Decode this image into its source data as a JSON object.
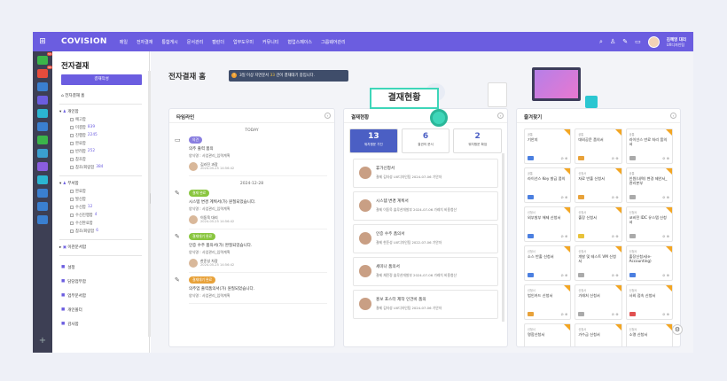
{
  "topnav": {
    "logo": "COVISION",
    "menu": [
      "메일",
      "전자결재",
      "통합게시",
      "문서관리",
      "캘린더",
      "업무도우미",
      "커뮤니티",
      "협업스페이스",
      "그룹웨어관리"
    ],
    "user_name": "김혜영 대리",
    "user_dept": "UX디자인팀"
  },
  "iconbar": {
    "badges": [
      "55",
      "99"
    ]
  },
  "sidebar": {
    "title": "전자결재",
    "write_btn": "결재작성",
    "home": "전자결재 홈",
    "personal": {
      "label": "개인함",
      "items": [
        {
          "label": "예고함",
          "count": ""
        },
        {
          "label": "미결함",
          "count": "839"
        },
        {
          "label": "진행함",
          "count": "2245"
        },
        {
          "label": "완료함",
          "count": ""
        },
        {
          "label": "반려함",
          "count": "252"
        },
        {
          "label": "참조함",
          "count": ""
        },
        {
          "label": "참조/회람함",
          "count": "384"
        }
      ]
    },
    "dept": {
      "label": "부서함",
      "items": [
        {
          "label": "완료함",
          "count": ""
        },
        {
          "label": "발신함",
          "count": ""
        },
        {
          "label": "수신함",
          "count": "12"
        },
        {
          "label": "수신진행함",
          "count": "4"
        },
        {
          "label": "수신완료함",
          "count": ""
        },
        {
          "label": "참조/회람함",
          "count": "6"
        }
      ]
    },
    "other": "이관문서함",
    "links": [
      "설정",
      "담당업무함",
      "업무문서함",
      "개인폴더",
      "감사함"
    ]
  },
  "main": {
    "title": "전자결재 홈",
    "notice_pre": "3일 이상 지연문서 ",
    "notice_num": "33",
    "notice_post": " 건이 결재대기 중입니다."
  },
  "timeline": {
    "title": "타임라인",
    "groups": [
      {
        "day": "TODAY",
        "items": [
          {
            "tag": "의견",
            "tag_color": "#8a7fe0",
            "title": "의주 출력 품의",
            "sub": "양식명 : 사업관리_입력계획",
            "user": "김라진 과장",
            "date": "2024-05-25 14:56:42"
          }
        ]
      },
      {
        "day": "2024-12-28",
        "items": [
          {
            "tag": "결재 완료",
            "tag_color": "#8ac640",
            "title": "시스템 변경 계획서(가) 원질되었습니다.",
            "sub": "양식명 : 사업관리_입력계획",
            "user": "이동욱 대리",
            "date": "2024-05-25 14:56:42"
          },
          {
            "tag": "결재대기 완료",
            "tag_color": "#8ac640",
            "title": "인증 수주 품의서(가) 완질되었습니다.",
            "sub": "양식명 : 사업관리_입력계획",
            "user": "한준성 차장",
            "date": "2024-05-25 14:56:42"
          },
          {
            "tag": "결재대기 완료",
            "tag_color": "#e8a23a",
            "title": "의주업 출력품의서(가) 원질되었습니다.",
            "sub": "양식명 : 사업관리_입력계획",
            "user": "",
            "date": ""
          }
        ]
      }
    ]
  },
  "approval": {
    "title": "결재현황",
    "stats": [
      {
        "value": "13",
        "label": "워치쟁운 가진"
      },
      {
        "value": "6",
        "label": "결권의 문서"
      },
      {
        "value": "2",
        "label": "워치쟁운 확엄"
      }
    ],
    "docs": [
      {
        "title": "휴가신청서",
        "sub": "결제 김자성 UX디자인팀 2024-07-06 기안자"
      },
      {
        "title": "시스템 변경 계획서",
        "sub": "결제 이동욱 솔루션개발부 2024-07-06 가레치 비용청산"
      },
      {
        "title": "인증 수주 품의서",
        "sub": "결제 한준성 UX디자인팀 2022-07-06 기안자"
      },
      {
        "title": "세미나 품의서",
        "sub": "결제 채민정 솔루션개발부 2024-07-06 가레치 비용청산"
      },
      {
        "title": "홍보 포스터 제작 인건비 품의",
        "sub": "결제 김자성 UX디자인팀 2024-07-06 기안자"
      }
    ]
  },
  "favorites": {
    "title": "즐겨찾기",
    "items": [
      {
        "type": "공통",
        "name": "기안지",
        "icon": "#4b7fe0"
      },
      {
        "type": "공통",
        "name": "대외공문 품의서",
        "icon": "#e8a23a"
      },
      {
        "type": "공통",
        "name": "라이선스 만료 처리 품의서",
        "icon": "#aaa"
      },
      {
        "type": "공통",
        "name": "라이선스 Key 발급 품의",
        "icon": "#4b7fe0"
      },
      {
        "type": "신청서",
        "name": "자료 반출 신청서",
        "icon": "#e8a23a"
      },
      {
        "type": "공통",
        "name": "인원(내역) 변경 제안서_관리본부",
        "icon": "#aaa"
      },
      {
        "type": "신청서",
        "name": "외부발부 해제 신청서",
        "icon": "#4b7fe0"
      },
      {
        "type": "신청서",
        "name": "출장 신청서",
        "icon": "#e8c23a"
      },
      {
        "type": "신청서",
        "name": "코비전 IDC 유스탬 신청서",
        "icon": "#aaa"
      },
      {
        "type": "신청서",
        "name": "소스 반출 신청서",
        "icon": "#4b7fe0"
      },
      {
        "type": "신청서",
        "name": "개발 및 테스트 VM 신청서",
        "icon": "#aaa"
      },
      {
        "type": "신청서",
        "name": "출장신청서(e-Accounting)",
        "icon": "#4b7fe0"
      },
      {
        "type": "신청서",
        "name": "법인카드 신청서",
        "icon": "#e8a23a"
      },
      {
        "type": "신청서",
        "name": "기래처 신청서",
        "icon": "#aaa"
      },
      {
        "type": "신청서",
        "name": "사외 접속 신청서",
        "icon": "#e05050"
      },
      {
        "type": "신청서",
        "name": "명함신청서",
        "icon": "#aaa"
      },
      {
        "type": "신청서",
        "name": "가수금 신청서",
        "icon": "#aaa"
      },
      {
        "type": "신청서",
        "name": "소명 신청서",
        "icon": "#aaa"
      }
    ]
  },
  "highlight": {
    "label": "결재현황"
  }
}
